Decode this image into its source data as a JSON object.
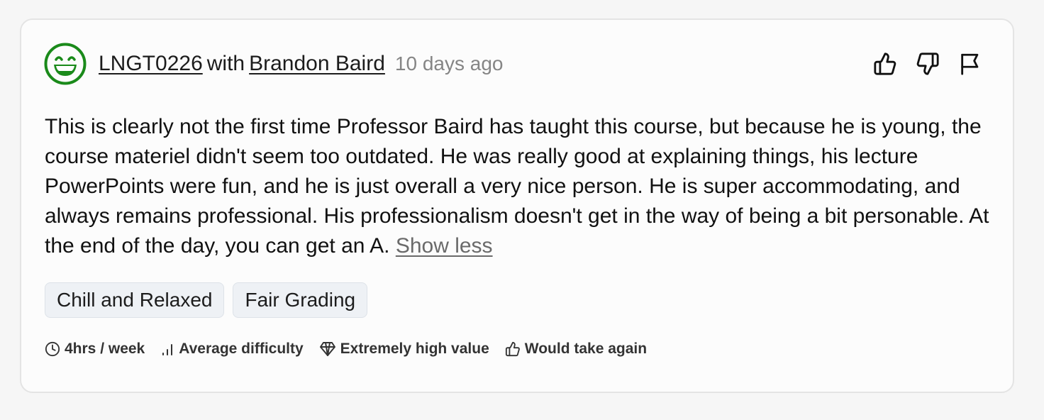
{
  "review": {
    "course_code": "LNGT0226",
    "with_word": "with",
    "professor": "Brandon Baird",
    "time_ago": "10 days ago",
    "body": "This is clearly not the first time Professor Baird has taught this course, but because he is young, the course materiel didn't seem too outdated. He was really good at explaining things, his lecture PowerPoints were fun, and he is just overall a very nice person. He is super accommodating, and always remains professional. His professionalism doesn't get in the way of being a bit personable. At the end of the day, you can get an A.",
    "show_less": "Show less",
    "tags": [
      "Chill and Relaxed",
      "Fair Grading"
    ],
    "stats": {
      "workload": "4hrs / week",
      "difficulty": "Average difficulty",
      "value": "Extremely high value",
      "take_again": "Would take again"
    }
  },
  "icons": {
    "avatar": "grinning-face-icon",
    "upvote": "thumbs-up-icon",
    "downvote": "thumbs-down-icon",
    "report": "flag-icon",
    "workload": "clock-icon",
    "difficulty": "bar-chart-icon",
    "value": "diamond-icon",
    "take_again": "thumbs-up-icon"
  },
  "colors": {
    "avatar_green": "#1a8a1a"
  }
}
